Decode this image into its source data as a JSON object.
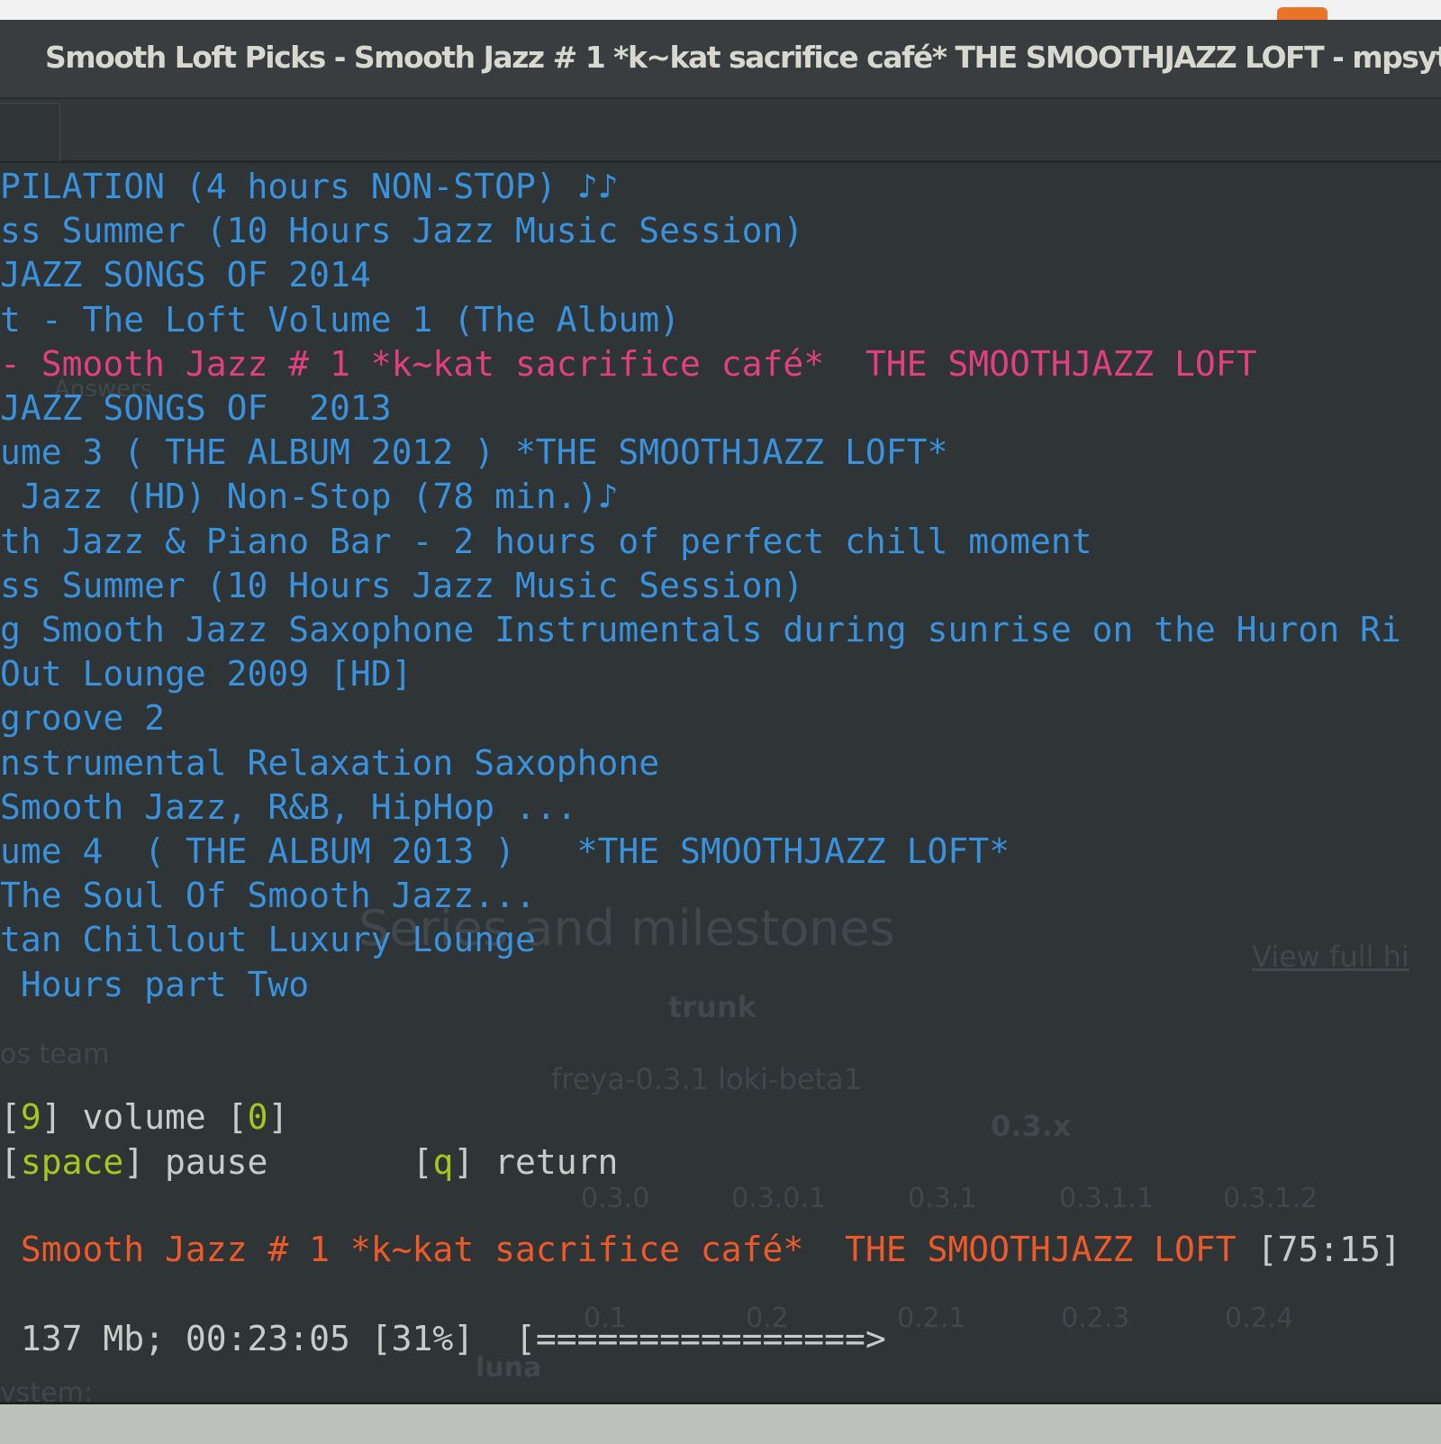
{
  "window": {
    "title": "Smooth Loft Picks - Smooth Jazz # 1 *k~kat sacrifice café*  THE SMOOTHJAZZ LOFT - mpsyt"
  },
  "playlist": [
    "PILATION (4 hours NON-STOP) ♪♪",
    "ss Summer (10 Hours Jazz Music Session)",
    "JAZZ SONGS OF 2014",
    "t - The Loft Volume 1 (The Album)",
    "- Smooth Jazz # 1 *k~kat sacrifice café*  THE SMOOTHJAZZ LOFT",
    "JAZZ SONGS OF  2013",
    "ume 3 ( THE ALBUM 2012 ) *THE SMOOTHJAZZ LOFT*",
    " Jazz (HD) Non-Stop (78 min.)♪",
    "th Jazz & Piano Bar - 2 hours of perfect chill moment",
    "ss Summer (10 Hours Jazz Music Session)",
    "g Smooth Jazz Saxophone Instrumentals during sunrise on the Huron Ri",
    "Out Lounge 2009 [HD]",
    "groove 2",
    "nstrumental Relaxation Saxophone",
    "Smooth Jazz, R&B, HipHop ...",
    "ume 4  ( THE ALBUM 2013 )   *THE SMOOTHJAZZ LOFT*",
    "The Soul Of Smooth Jazz...",
    "tan Chillout Luxury Lounge",
    " Hours part Two"
  ],
  "selected_index": 4,
  "controls": {
    "vol_down_key": "9",
    "volume_label": "volume",
    "vol_up_key": "0",
    "pause_key": "space",
    "pause_label": "pause",
    "return_key": "q",
    "return_label": "return"
  },
  "now_playing": {
    "title": " Smooth Jazz # 1 *k~kat sacrifice café*  THE SMOOTHJAZZ LOFT",
    "duration": "[75:15]"
  },
  "progress": {
    "text": " 137 Mb; 00:23:05 [31%]  [================>",
    "percent": 31
  },
  "background_ghost": [
    "Answers",
    "Series and milestones",
    "View full hi",
    "trunk",
    "freya-0.3.1  loki-beta1",
    "0.3.x",
    "0.3.0",
    "0.3.0.1",
    "0.3.1",
    "0.3.1.1",
    "0.3.1.2",
    "0.1",
    "0.2",
    "0.2.1",
    "0.2.3",
    "0.2.4",
    "luna",
    "os team",
    "ystem:"
  ],
  "colors": {
    "background": "#2f3436",
    "list_text": "#3a91dc",
    "selected": "#e0407c",
    "now_playing": "#ec5a2a",
    "key": "#a8c41e"
  }
}
